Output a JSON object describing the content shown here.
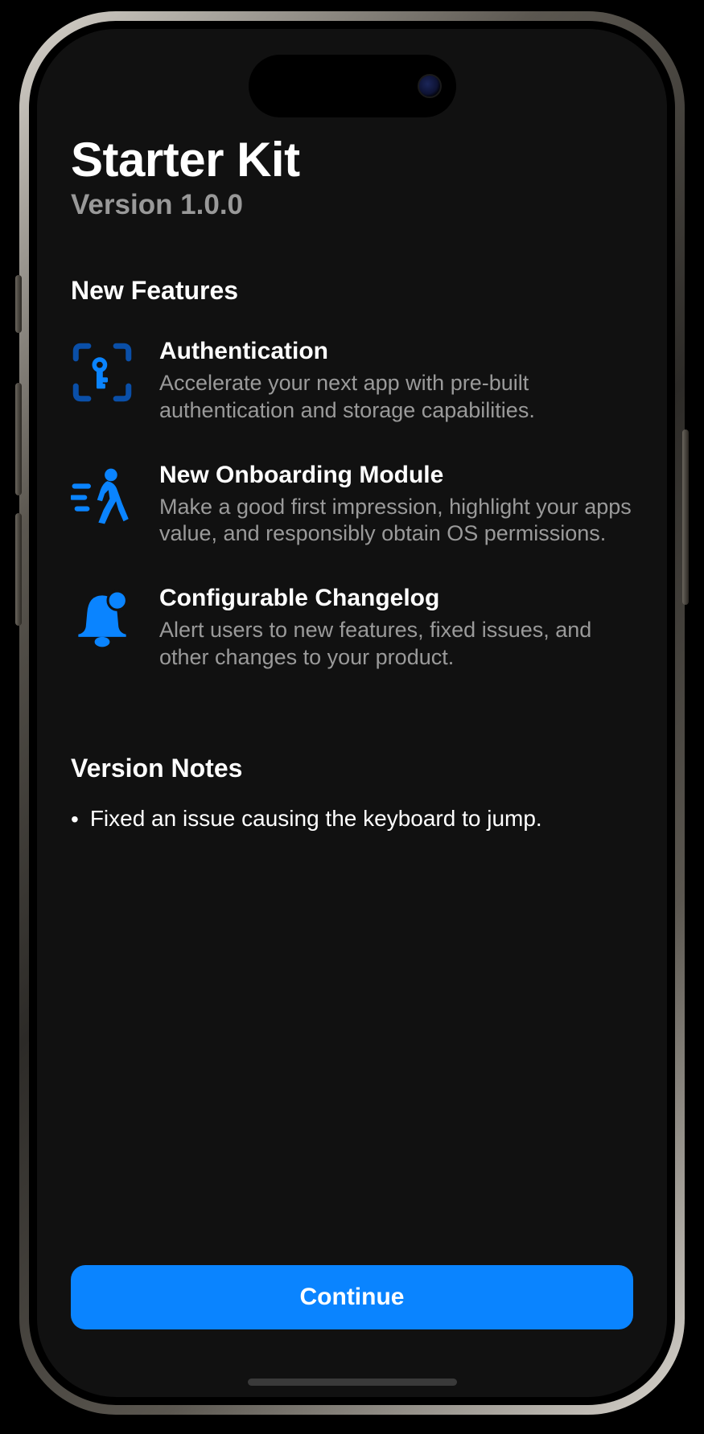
{
  "header": {
    "title": "Starter Kit",
    "version": "Version 1.0.0"
  },
  "sections": {
    "features_heading": "New Features",
    "notes_heading": "Version Notes"
  },
  "features": [
    {
      "icon": "scan-key-icon",
      "title": "Authentication",
      "description": "Accelerate your next app with pre-built authentication and storage capabilities."
    },
    {
      "icon": "walk-fast-icon",
      "title": "New Onboarding Module",
      "description": "Make a good first impression, highlight your apps value, and responsibly obtain OS permissions."
    },
    {
      "icon": "bell-badge-icon",
      "title": "Configurable Changelog",
      "description": "Alert users to new features, fixed issues, and other changes to your product."
    }
  ],
  "notes": [
    "Fixed an issue causing the keyboard to jump."
  ],
  "continue_label": "Continue",
  "colors": {
    "accent": "#0a84ff"
  }
}
